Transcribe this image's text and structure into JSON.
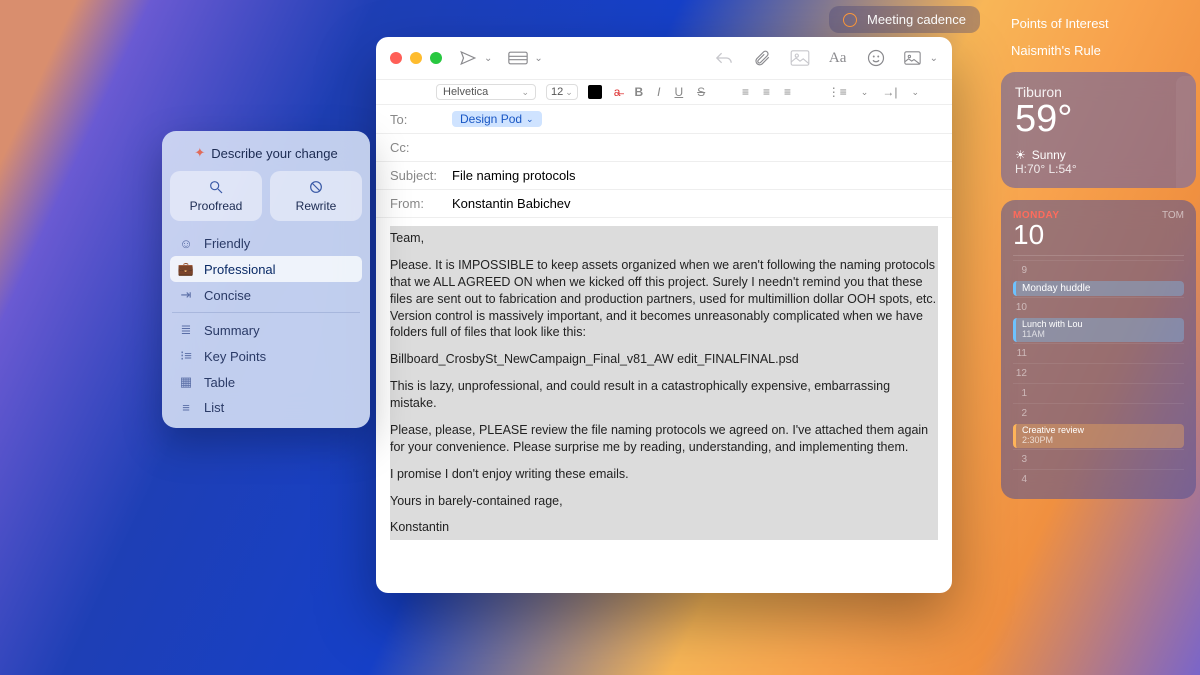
{
  "reminder": {
    "label": "Meeting cadence"
  },
  "notes": {
    "items": [
      "Points of Interest",
      "Naismith's Rule"
    ]
  },
  "weather": {
    "city": "Tiburon",
    "temp": "59°",
    "cond": "Sunny",
    "hilo": "H:70° L:54°"
  },
  "calendar": {
    "day_label": "MONDAY",
    "tomorrow_label": "TOM",
    "date": "10",
    "hours": [
      "9",
      "10",
      "11",
      "12",
      "1",
      "2",
      "3",
      "4"
    ],
    "events": [
      {
        "title": "Monday huddle",
        "sub": ""
      },
      {
        "title": "Lunch with Lou",
        "sub": "11AM"
      },
      {
        "title": "Creative review",
        "sub": "2:30PM"
      }
    ]
  },
  "popover": {
    "prompt": "Describe your change",
    "buttons": {
      "proofread": "Proofread",
      "rewrite": "Rewrite"
    },
    "tones": [
      "Friendly",
      "Professional",
      "Concise"
    ],
    "formats": [
      "Summary",
      "Key Points",
      "Table",
      "List"
    ],
    "selected": "Professional"
  },
  "compose": {
    "format": {
      "font": "Helvetica",
      "size": "12"
    },
    "fields": {
      "to_label": "To:",
      "to_value": "Design Pod",
      "cc_label": "Cc:",
      "subject_label": "Subject:",
      "subject_value": "File naming protocols",
      "from_label": "From:",
      "from_value": "Konstantin Babichev"
    },
    "body": {
      "greeting": "Team,",
      "p1": "Please. It is IMPOSSIBLE to keep assets organized when we aren't following the naming protocols that we ALL AGREED ON when we kicked off this project. Surely I needn't remind you that these files are sent out to fabrication and production partners, used for multimillion dollar OOH spots, etc. Version control is massively important, and it becomes unreasonably complicated when we have folders full of files that look like this:",
      "p2": "Billboard_CrosbySt_NewCampaign_Final_v81_AW edit_FINALFINAL.psd",
      "p3": "This is lazy, unprofessional, and could result in a catastrophically expensive, embarrassing mistake.",
      "p4": "Please, please, PLEASE review the file naming protocols we agreed on. I've attached them again for your convenience. Please surprise me by reading, understanding, and implementing them.",
      "p5": "I promise I don't enjoy writing these emails.",
      "p6": "Yours in barely-contained rage,",
      "p7": "Konstantin"
    }
  }
}
